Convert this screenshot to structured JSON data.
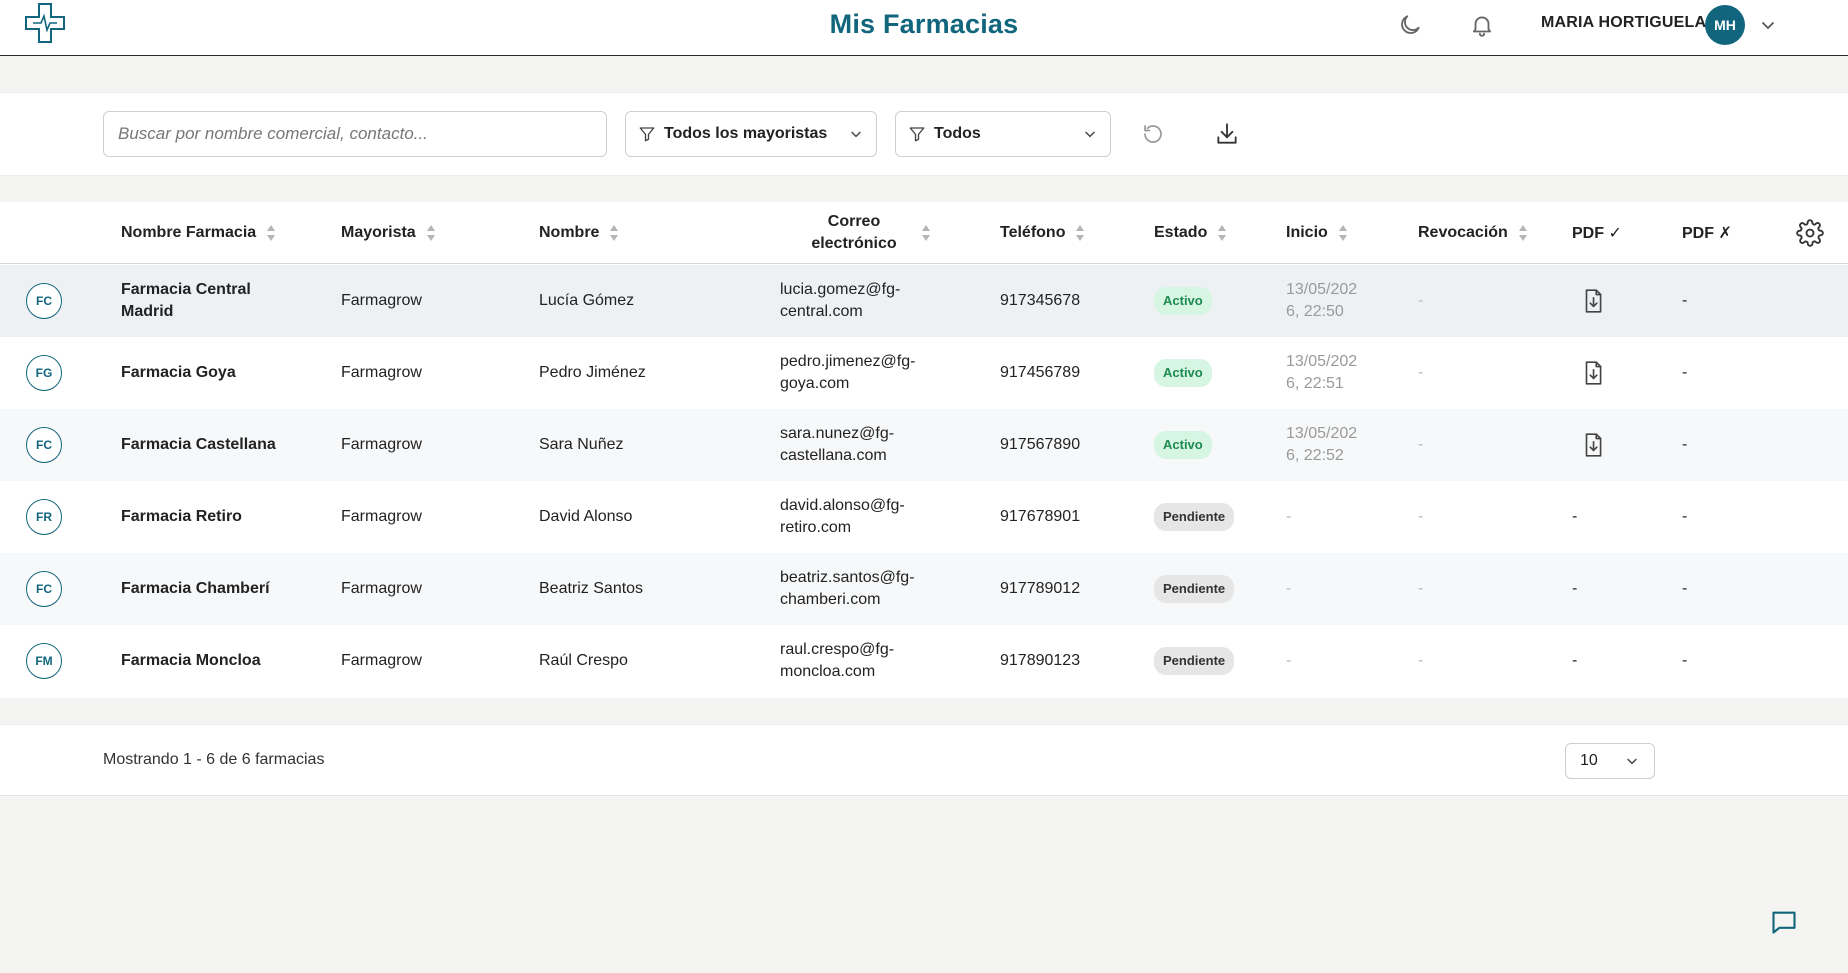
{
  "header": {
    "title": "Mis Farmacias",
    "user_name": "MARIA HORTIGUELA",
    "user_initials": "MH",
    "icons": [
      "logo-cross-icon",
      "moon-icon",
      "bell-icon",
      "chevron-down-icon"
    ]
  },
  "filters": {
    "search_placeholder": "Buscar por nombre comercial, contacto...",
    "search_value": "",
    "wholesaler_filter": "Todos los mayoristas",
    "status_filter": "Todos",
    "icons": [
      "filter-icon",
      "refresh-icon",
      "download-icon"
    ]
  },
  "table": {
    "columns": {
      "name": "Nombre Farmacia",
      "wholesaler": "Mayorista",
      "contact": "Nombre",
      "email_line1": "Correo",
      "email_line2": "electrónico",
      "phone": "Teléfono",
      "status": "Estado",
      "start": "Inicio",
      "revocation": "Revocación",
      "pdf_ok": "PDF ✓",
      "pdf_ko": "PDF ✗"
    },
    "rows": [
      {
        "initials": "FC",
        "name_l1": "Farmacia Central",
        "name_l2": "Madrid",
        "wholesaler": "Farmagrow",
        "contact": "Lucía Gómez",
        "email_l1": "lucia.gomez@fg-",
        "email_l2": "central.com",
        "phone": "917345678",
        "status": "Activo",
        "start_l1": "13/05/202",
        "start_l2": "6, 22:50",
        "revocation": "-",
        "pdf_ok": "pdf-download-icon",
        "pdf_ko": "-"
      },
      {
        "initials": "FG",
        "name_l1": "Farmacia Goya",
        "name_l2": "",
        "wholesaler": "Farmagrow",
        "contact": "Pedro Jiménez",
        "email_l1": "pedro.jimenez@fg-",
        "email_l2": "goya.com",
        "phone": "917456789",
        "status": "Activo",
        "start_l1": "13/05/202",
        "start_l2": "6, 22:51",
        "revocation": "-",
        "pdf_ok": "pdf-download-icon",
        "pdf_ko": "-"
      },
      {
        "initials": "FC",
        "name_l1": "Farmacia Castellana",
        "name_l2": "",
        "wholesaler": "Farmagrow",
        "contact": "Sara Nuñez",
        "email_l1": "sara.nunez@fg-",
        "email_l2": "castellana.com",
        "phone": "917567890",
        "status": "Activo",
        "start_l1": "13/05/202",
        "start_l2": "6, 22:52",
        "revocation": "-",
        "pdf_ok": "pdf-download-icon",
        "pdf_ko": "-"
      },
      {
        "initials": "FR",
        "name_l1": "Farmacia Retiro",
        "name_l2": "",
        "wholesaler": "Farmagrow",
        "contact": "David Alonso",
        "email_l1": "david.alonso@fg-",
        "email_l2": "retiro.com",
        "phone": "917678901",
        "status": "Pendiente",
        "start_l1": "-",
        "start_l2": "",
        "revocation": "-",
        "pdf_ok": "-",
        "pdf_ko": "-"
      },
      {
        "initials": "FC",
        "name_l1": "Farmacia Chamberí",
        "name_l2": "",
        "wholesaler": "Farmagrow",
        "contact": "Beatriz Santos",
        "email_l1": "beatriz.santos@fg-",
        "email_l2": "chamberi.com",
        "phone": "917789012",
        "status": "Pendiente",
        "start_l1": "-",
        "start_l2": "",
        "revocation": "-",
        "pdf_ok": "-",
        "pdf_ko": "-"
      },
      {
        "initials": "FM",
        "name_l1": "Farmacia Moncloa",
        "name_l2": "",
        "wholesaler": "Farmagrow",
        "contact": "Raúl Crespo",
        "email_l1": "raul.crespo@fg-",
        "email_l2": "moncloa.com",
        "phone": "917890123",
        "status": "Pendiente",
        "start_l1": "-",
        "start_l2": "",
        "revocation": "-",
        "pdf_ok": "-",
        "pdf_ko": "-"
      }
    ]
  },
  "footer": {
    "summary": "Mostrando 1 - 6 de 6 farmacias",
    "page_size": "10"
  },
  "colors": {
    "brand": "#11667e",
    "active_bg": "#d7f5e3",
    "active_text": "#1d8a4e",
    "pending_bg": "#e6e6e6"
  }
}
